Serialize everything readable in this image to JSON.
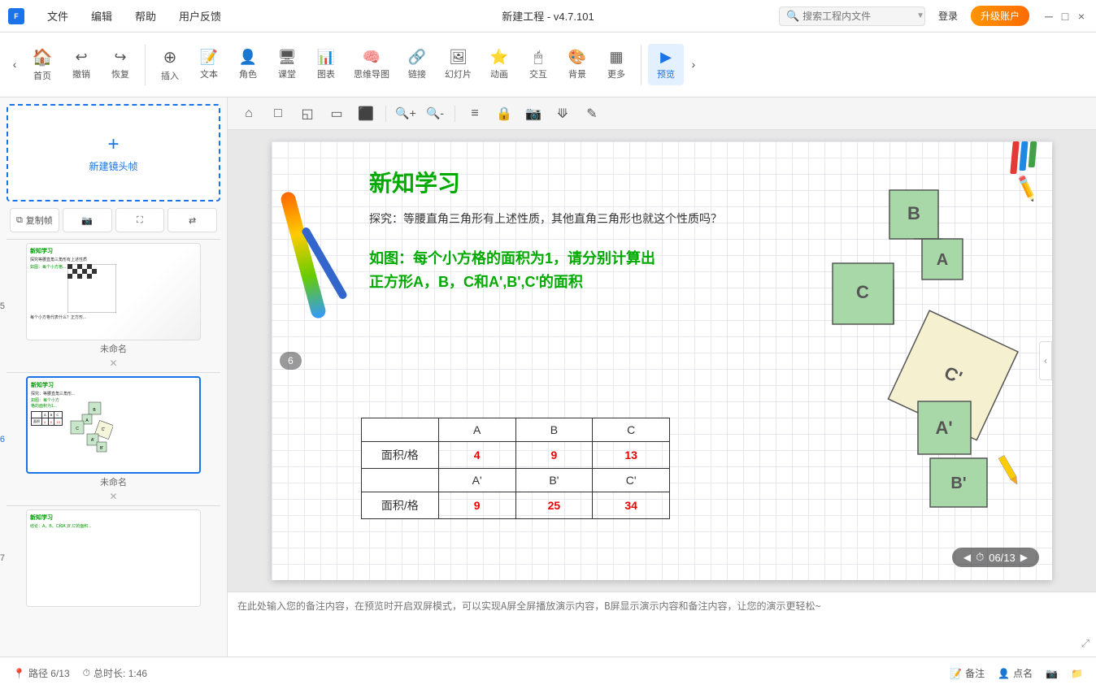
{
  "titlebar": {
    "logo": "FIt",
    "menu": [
      "文件",
      "编辑",
      "帮助",
      "用户反馈"
    ],
    "title": "新建工程 - v4.7.101",
    "search_placeholder": "搜索工程内文件",
    "login": "登录",
    "upgrade": "升级账户",
    "window_min": "─",
    "window_max": "□",
    "window_close": "×"
  },
  "toolbar": {
    "nav_left": "‹",
    "nav_right": "›",
    "items": [
      {
        "id": "home",
        "icon": "🏠",
        "label": "首页"
      },
      {
        "id": "undo",
        "icon": "↩",
        "label": "撤销"
      },
      {
        "id": "redo",
        "icon": "↪",
        "label": "恢复"
      },
      {
        "id": "insert",
        "icon": "⊕",
        "label": "插入"
      },
      {
        "id": "text",
        "icon": "📄",
        "label": "文本"
      },
      {
        "id": "role",
        "icon": "👤",
        "label": "角色"
      },
      {
        "id": "class",
        "icon": "🖥",
        "label": "课堂"
      },
      {
        "id": "chart",
        "icon": "📊",
        "label": "图表"
      },
      {
        "id": "mindmap",
        "icon": "🧠",
        "label": "思维导图"
      },
      {
        "id": "link",
        "icon": "🔗",
        "label": "链接"
      },
      {
        "id": "slide",
        "icon": "🖼",
        "label": "幻灯片"
      },
      {
        "id": "animation",
        "icon": "⭐",
        "label": "动画"
      },
      {
        "id": "interact",
        "icon": "🖱",
        "label": "交互"
      },
      {
        "id": "bg",
        "icon": "🖼",
        "label": "背景"
      },
      {
        "id": "more",
        "icon": "▦",
        "label": "更多"
      },
      {
        "id": "preview",
        "icon": "▶",
        "label": "预览"
      }
    ]
  },
  "canvas_toolbar": {
    "tools": [
      "⌂",
      "□",
      "◱",
      "▭",
      "⬛",
      "🔍+",
      "🔍-",
      "≡",
      "🔒",
      "📷",
      "⟱",
      "✎"
    ]
  },
  "slide": {
    "title": "新知学习",
    "question": "探究：等腰直角三角形有上述性质，其他直角三角形也就这个性质吗？",
    "main_text": "如图：每个小方格的面积为1，请分别计算出正方形A，B，C和A',B',C'的面积",
    "table": {
      "headers": [
        "",
        "A",
        "B",
        "C"
      ],
      "row1_label": "面积/格",
      "row1_values": [
        "4",
        "9",
        "13"
      ],
      "headers2": [
        "",
        "A'",
        "B'",
        "C'"
      ],
      "row2_label": "面积/格",
      "row2_values": [
        "9",
        "25",
        "34"
      ]
    }
  },
  "sidebar": {
    "new_frame_label": "新建镜头帧",
    "actions": [
      "复制帧",
      "📷",
      "⛶",
      "⇄"
    ],
    "slides": [
      {
        "num": "05",
        "name": "未命名",
        "active": false
      },
      {
        "num": "06",
        "name": "未命名",
        "active": true
      },
      {
        "num": "07",
        "name": "",
        "active": false
      }
    ]
  },
  "notes": {
    "placeholder": "在此处输入您的备注内容，在预览时开启双屏模式，可以实现A屏全屏播放演示内容，B屏显示演示内容和备注内容，让您的演示更轻松~"
  },
  "statusbar": {
    "path": "路径 6/13",
    "duration": "总时长: 1:46",
    "counter": "06/13",
    "actions": [
      "备注",
      "点名",
      "📷",
      "📁"
    ]
  }
}
